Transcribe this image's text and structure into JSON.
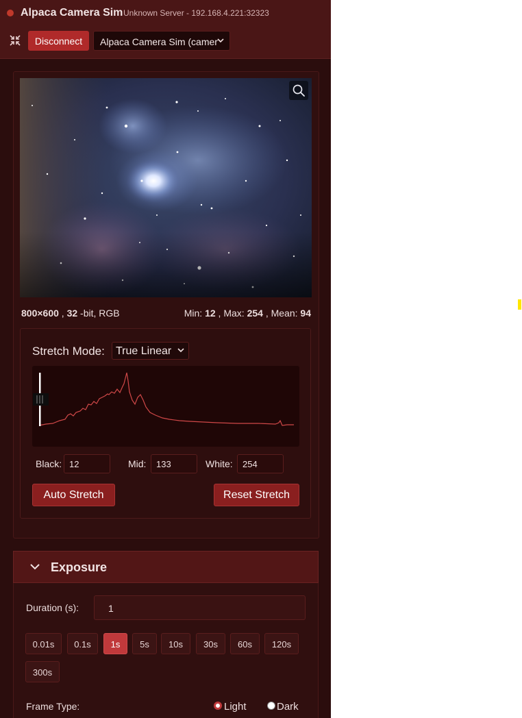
{
  "header": {
    "title": "Alpaca Camera Sim",
    "server": "Unknown Server - 192.168.4.221:32323",
    "disconnect_label": "Disconnect",
    "device": "Alpaca Camera Sim (camer",
    "status_color": "#c0392b"
  },
  "image": {
    "width": "800",
    "height": "600",
    "bitdepth": "32",
    "bit_suffix": "-bit, RGB",
    "min": "12",
    "max": "254",
    "mean": "94",
    "labels": {
      "min": "Min:",
      "max": "Max:",
      "mean": "Mean:"
    }
  },
  "stretch": {
    "label": "Stretch Mode:",
    "mode": "True Linear",
    "black_label": "Black:",
    "black": "12",
    "mid_label": "Mid:",
    "mid": "133",
    "white_label": "White:",
    "white": "254",
    "auto_label": "Auto Stretch",
    "reset_label": "Reset Stretch"
  },
  "exposure": {
    "title": "Exposure",
    "duration_label": "Duration (s):",
    "duration": "1",
    "presets": [
      "0.01s",
      "0.1s",
      "1s",
      "5s",
      "10s",
      "30s",
      "60s",
      "120s",
      "300s"
    ],
    "active_preset": "1s",
    "frame_type_label": "Frame Type:",
    "frame_types": [
      "Light",
      "Dark"
    ],
    "selected_frame_type": "Light"
  },
  "colors": {
    "accent": "#b02a2a",
    "panel_bg": "#2b0d0d",
    "header_bg": "#4a1616"
  },
  "icons": [
    "collapse-icon",
    "chevron-down-icon",
    "search-icon",
    "radio-icon"
  ]
}
